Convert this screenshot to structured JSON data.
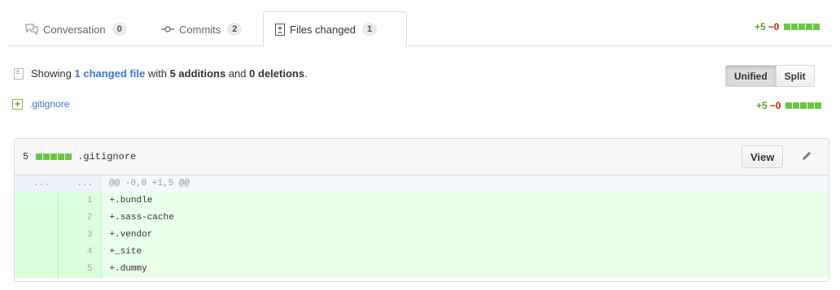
{
  "tabs": [
    {
      "label": "Conversation",
      "count": "0"
    },
    {
      "label": "Commits",
      "count": "2"
    },
    {
      "label": "Files changed",
      "count": "1"
    }
  ],
  "diffstat": {
    "additions": "+5",
    "deletions": "−0"
  },
  "toc": {
    "prefix": "Showing",
    "changed_files": "1 changed file",
    "with": "with",
    "additions": "5 additions",
    "and": "and",
    "deletions": "0 deletions",
    "suffix": "."
  },
  "view_toggle": {
    "unified": "Unified",
    "split": "Split",
    "selected": "unified"
  },
  "file_list": [
    {
      "name": ".gitignore",
      "additions": "+5",
      "deletions": "−0"
    }
  ],
  "file": {
    "changes": "5",
    "name": ".gitignore",
    "view_label": "View",
    "hunk_header": "@@ -0,0 +1,5 @@",
    "lines": [
      {
        "old": "",
        "new": "1",
        "code": "+.bundle"
      },
      {
        "old": "",
        "new": "2",
        "code": "+.sass-cache"
      },
      {
        "old": "",
        "new": "3",
        "code": "+.vendor"
      },
      {
        "old": "",
        "new": "4",
        "code": "+_site"
      },
      {
        "old": "",
        "new": "5",
        "code": "+.dummy"
      }
    ]
  },
  "colors": {
    "addition": "#55a532",
    "deletion": "#bd2c00",
    "link": "#4078c0",
    "added_bg": "#eaffea"
  },
  "icons": [
    "comment-discussion-icon",
    "git-commit-icon",
    "file-diff-icon",
    "diff-added-icon",
    "pencil-icon"
  ]
}
